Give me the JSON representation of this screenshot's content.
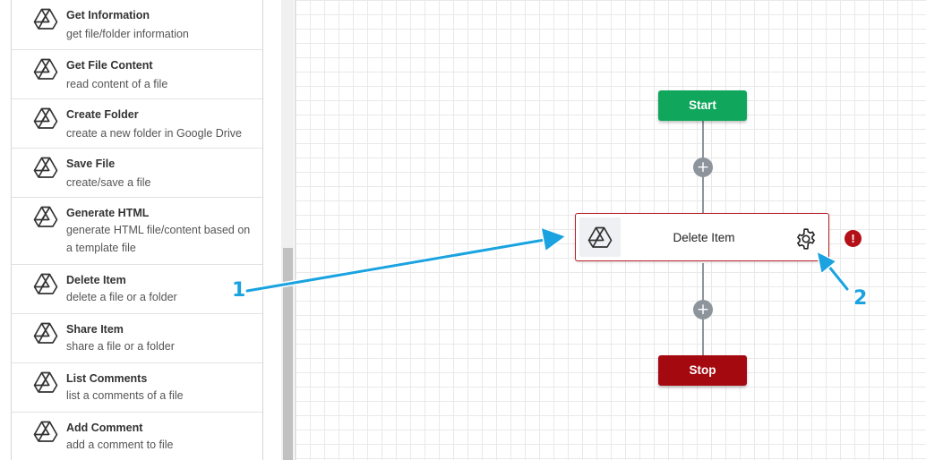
{
  "actions": [
    {
      "title": "Get Information",
      "desc": "get file/folder information"
    },
    {
      "title": "Get File Content",
      "desc": "read content of a file"
    },
    {
      "title": "Create Folder",
      "desc": "create a new folder in Google Drive"
    },
    {
      "title": "Save File",
      "desc": "create/save a file"
    },
    {
      "title": "Generate HTML",
      "desc": "generate HTML file/content based on a template file"
    },
    {
      "title": "Delete Item",
      "desc": "delete a file or a folder"
    },
    {
      "title": "Share Item",
      "desc": "share a file or a folder"
    },
    {
      "title": "List Comments",
      "desc": "list a comments of a file"
    },
    {
      "title": "Add Comment",
      "desc": "add a comment to file"
    }
  ],
  "flow": {
    "start_label": "Start",
    "stop_label": "Stop",
    "plus_symbol": "+",
    "node_label": "Delete Item",
    "alert_symbol": "!"
  },
  "callouts": [
    "1",
    "2"
  ],
  "icons": {
    "action": "google-drive-icon",
    "settings": "gear-icon",
    "add": "plus-icon",
    "error": "error-icon"
  },
  "colors": {
    "start": "#10a75c",
    "stop": "#a4090f",
    "node_border": "#b8202b",
    "alert": "#b31017",
    "callout": "#1aa3e0",
    "connector": "#8d949c"
  }
}
